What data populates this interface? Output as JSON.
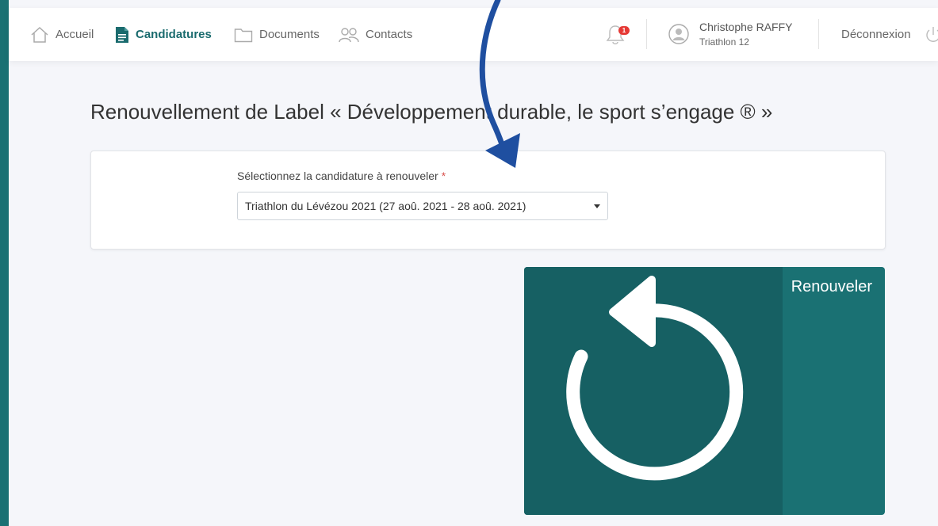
{
  "nav": {
    "home_label": "Accueil",
    "applications_label": "Candidatures",
    "documents_label": "Documents",
    "contacts_label": "Contacts"
  },
  "notifications": {
    "count": "1"
  },
  "user": {
    "name": "Christophe RAFFY",
    "organization": "Triathlon 12"
  },
  "logout_label": "Déconnexion",
  "page": {
    "title": "Renouvellement de Label « Développement durable, le sport s’engage ® »"
  },
  "form": {
    "label": "Sélectionnez la candidature à renouveler",
    "required_mark": "*",
    "selected": "Triathlon du Lévézou 2021 (27 aoû. 2021 - 28 aoû. 2021)"
  },
  "tile": {
    "label": "Renouveler",
    "icon": "renew-icon"
  },
  "colors": {
    "accent": "#1a7173",
    "accent_dark": "#166063",
    "badge": "#e53935",
    "annotation_arrow": "#1f4fa0"
  }
}
